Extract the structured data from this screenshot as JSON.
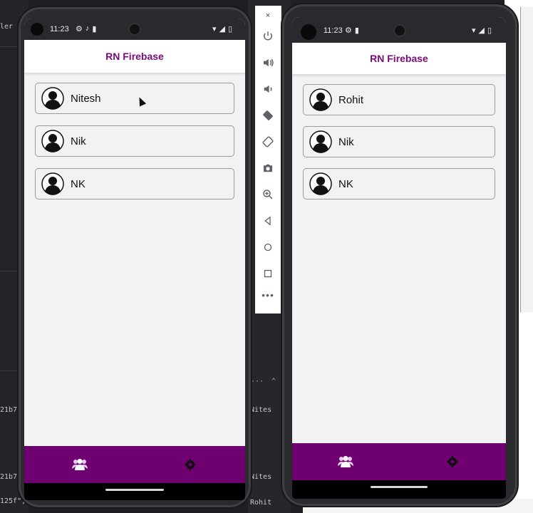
{
  "background": {
    "left_snippet": "ler",
    "code_lines": [
      "21b7\"",
      "21b7\"",
      "125f\","
    ],
    "right_code": [
      "Nites",
      "Nites",
      "Rohit"
    ],
    "ellipsis": "···",
    "caret": "^"
  },
  "emulator_toolbar": {
    "close": "×",
    "buttons": [
      "power-icon",
      "volume-up-icon",
      "volume-down-icon",
      "rotate-left-icon",
      "rotate-right-icon",
      "camera-icon",
      "zoom-icon",
      "back-icon",
      "home-icon",
      "overview-icon"
    ],
    "more": "•••"
  },
  "phone_left": {
    "status_time": "11:23",
    "header_title": "RN Firebase",
    "users": [
      "Nitesh",
      "Nik",
      "NK"
    ]
  },
  "phone_right": {
    "status_time": "11:23",
    "header_title": "RN Firebase",
    "users": [
      "Rohit",
      "Nik",
      "NK"
    ]
  },
  "colors": {
    "accent": "#7a0a7a",
    "tabbar": "#6e0070"
  }
}
